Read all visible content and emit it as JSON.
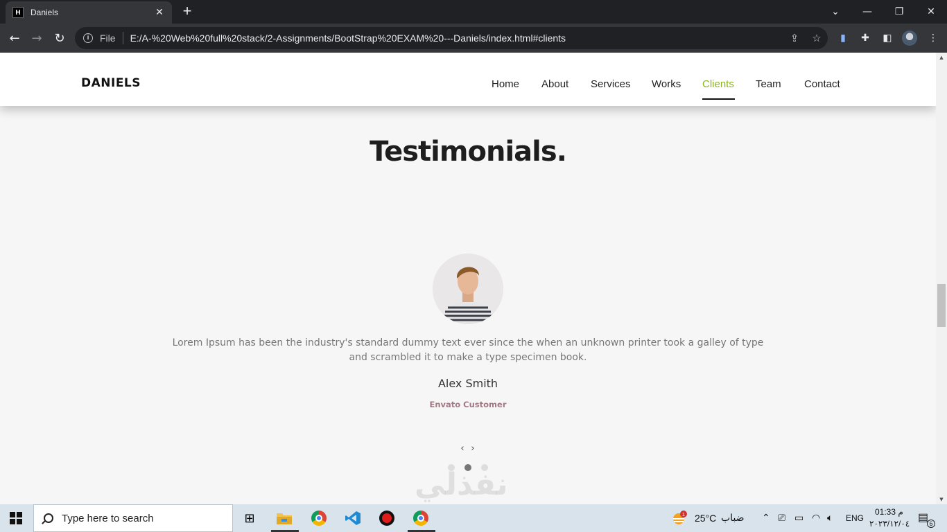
{
  "browser": {
    "tab_title": "Daniels",
    "tab_favicon_letter": "H",
    "file_label": "File",
    "url": "E:/A-%20Web%20full%20stack/2-Assignments/BootStrap%20EXAM%20---Daniels/index.html#clients"
  },
  "site": {
    "brand": "DANIELS",
    "nav": [
      "Home",
      "About",
      "Services",
      "Works",
      "Clients",
      "Team",
      "Contact"
    ],
    "active_nav": "Clients",
    "accent_color": "#8bb31d"
  },
  "testimonials": {
    "title": "Testimonials.",
    "quote": "Lorem Ipsum has been the industry's standard dummy text ever since the when an unknown printer took a galley of type and scrambled it to make a type specimen book.",
    "name": "Alex Smith",
    "role": "Envato Customer",
    "prev_arrow": "‹",
    "next_arrow": "›",
    "dots_count": 3,
    "active_dot": 2
  },
  "watermark": "نفذلي",
  "taskbar": {
    "search_placeholder": "Type here to search",
    "weather_temp": "25°C",
    "weather_text": "ضباب",
    "language": "ENG",
    "time": "01:33 م",
    "date": "٢٠٢٣/١٢/٠٤",
    "notification_badge": "6"
  }
}
